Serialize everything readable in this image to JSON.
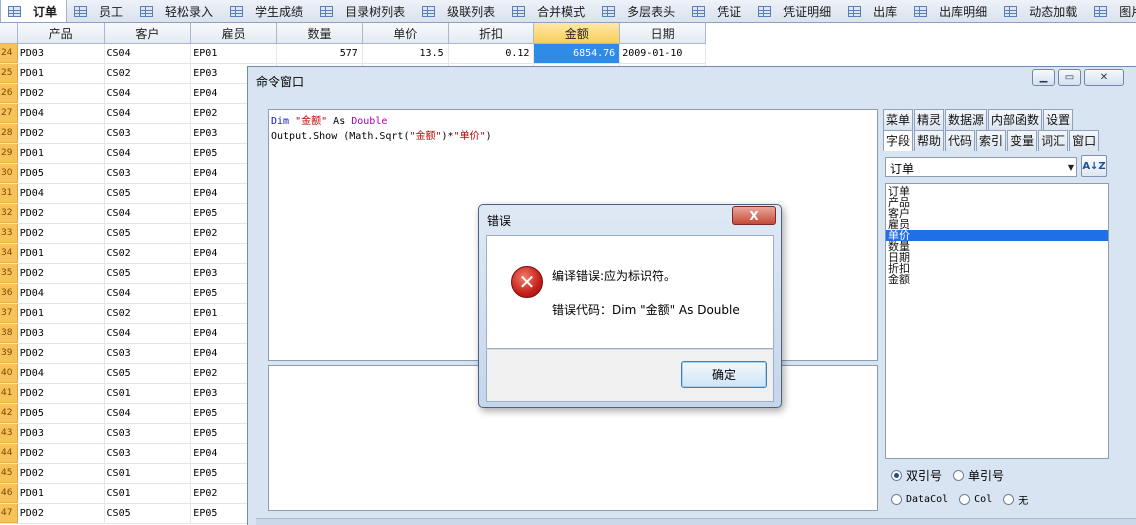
{
  "tabs": [
    {
      "label": "订单",
      "active": true
    },
    {
      "label": "员工"
    },
    {
      "label": "轻松录入"
    },
    {
      "label": "学生成绩"
    },
    {
      "label": "目录树列表"
    },
    {
      "label": "级联列表"
    },
    {
      "label": "合并模式"
    },
    {
      "label": "多层表头"
    },
    {
      "label": "凭证"
    },
    {
      "label": "凭证明细"
    },
    {
      "label": "出库"
    },
    {
      "label": "出库明细"
    },
    {
      "label": "动态加载"
    },
    {
      "label": "图片管理"
    }
  ],
  "grid": {
    "columns": [
      "产品",
      "客户",
      "雇员",
      "数量",
      "单价",
      "折扣",
      "金额",
      "日期"
    ],
    "first_row": {
      "num": "24",
      "product": "PD03",
      "customer": "CS04",
      "employee": "EP01",
      "qty": "577",
      "price": "13.5",
      "discount": "0.12",
      "amount": "6854.76",
      "date": "2009-01-10"
    },
    "rows": [
      {
        "num": "25",
        "product": "PD01",
        "customer": "CS02",
        "employee": "EP03"
      },
      {
        "num": "26",
        "product": "PD02",
        "customer": "CS04",
        "employee": "EP04"
      },
      {
        "num": "27",
        "product": "PD04",
        "customer": "CS04",
        "employee": "EP02"
      },
      {
        "num": "28",
        "product": "PD02",
        "customer": "CS03",
        "employee": "EP03"
      },
      {
        "num": "29",
        "product": "PD01",
        "customer": "CS04",
        "employee": "EP05"
      },
      {
        "num": "30",
        "product": "PD05",
        "customer": "CS03",
        "employee": "EP04"
      },
      {
        "num": "31",
        "product": "PD04",
        "customer": "CS05",
        "employee": "EP04"
      },
      {
        "num": "32",
        "product": "PD02",
        "customer": "CS04",
        "employee": "EP05"
      },
      {
        "num": "33",
        "product": "PD02",
        "customer": "CS05",
        "employee": "EP02"
      },
      {
        "num": "34",
        "product": "PD01",
        "customer": "CS02",
        "employee": "EP04"
      },
      {
        "num": "35",
        "product": "PD02",
        "customer": "CS05",
        "employee": "EP03"
      },
      {
        "num": "36",
        "product": "PD04",
        "customer": "CS04",
        "employee": "EP05"
      },
      {
        "num": "37",
        "product": "PD01",
        "customer": "CS02",
        "employee": "EP01"
      },
      {
        "num": "38",
        "product": "PD03",
        "customer": "CS04",
        "employee": "EP04"
      },
      {
        "num": "39",
        "product": "PD02",
        "customer": "CS03",
        "employee": "EP04"
      },
      {
        "num": "40",
        "product": "PD04",
        "customer": "CS05",
        "employee": "EP02"
      },
      {
        "num": "41",
        "product": "PD02",
        "customer": "CS01",
        "employee": "EP03"
      },
      {
        "num": "42",
        "product": "PD05",
        "customer": "CS04",
        "employee": "EP05"
      },
      {
        "num": "43",
        "product": "PD03",
        "customer": "CS03",
        "employee": "EP05"
      },
      {
        "num": "44",
        "product": "PD02",
        "customer": "CS03",
        "employee": "EP04"
      },
      {
        "num": "45",
        "product": "PD02",
        "customer": "CS01",
        "employee": "EP05"
      },
      {
        "num": "46",
        "product": "PD01",
        "customer": "CS01",
        "employee": "EP02"
      },
      {
        "num": "47",
        "product": "PD02",
        "customer": "CS05",
        "employee": "EP05"
      }
    ]
  },
  "command_window": {
    "title": "命令窗口",
    "code_line1": {
      "kw_dim": "Dim",
      "str": "\"金额\"",
      "kw_as": "As",
      "kw_type": "Double"
    },
    "code_line2": {
      "pre": "Output.Show (Math.Sqrt(",
      "str1": "\"金额\"",
      "mid": ")*",
      "str2": "\"单价\"",
      "post": ")"
    },
    "panel_tabs_row1": [
      "菜单",
      "精灵",
      "数据源",
      "内部函数",
      "设置"
    ],
    "panel_tabs_row2": [
      "字段",
      "帮助",
      "代码",
      "索引",
      "变量",
      "词汇",
      "窗口"
    ],
    "table_select": "订单",
    "sort_label": "A↓Z",
    "fields": [
      "订单",
      "产品",
      "客户",
      "雇员",
      "单价",
      "数量",
      "日期",
      "折扣",
      "金额"
    ],
    "selected_field": "单价",
    "radios_row1": [
      {
        "label": "双引号",
        "checked": true
      },
      {
        "label": "单引号",
        "checked": false
      }
    ],
    "radios_row2": [
      {
        "label": "DataCol",
        "checked": false
      },
      {
        "label": "Col",
        "checked": false
      },
      {
        "label": "无",
        "checked": false
      }
    ]
  },
  "dialog": {
    "title": "错误",
    "close_label": "X",
    "message": "编译错误:应为标识符。",
    "code_text": "错误代码：Dim \"金额\" As Double",
    "ok_label": "确定"
  }
}
